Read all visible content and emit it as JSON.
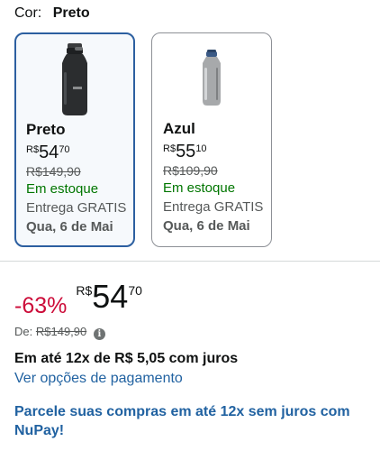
{
  "color_selector": {
    "label": "Cor:",
    "selected": "Preto"
  },
  "options": [
    {
      "name": "Preto",
      "price": {
        "currency": "R$",
        "integer": "54",
        "decimal": "70"
      },
      "list_price": "R$149,90",
      "availability": "Em estoque",
      "shipping": "Entrega GRATIS",
      "delivery_date": "Qua, 6 de Mai",
      "bottle_color": "#2b2d2f",
      "selected": true
    },
    {
      "name": "Azul",
      "price": {
        "currency": "R$",
        "integer": "55",
        "decimal": "10"
      },
      "list_price": "R$109,90",
      "availability": "Em estoque",
      "shipping": "Entrega GRATIS",
      "delivery_date": "Qua, 6 de Mai",
      "bottle_color": "#a7a9ab",
      "selected": false
    }
  ],
  "price_block": {
    "discount": "-63%",
    "currency": "R$",
    "integer": "54",
    "decimal": "70",
    "list_price_label": "De:",
    "list_price": "R$149,90",
    "info_icon": "info-icon"
  },
  "installments": "Em até 12x de R$ 5,05 com juros",
  "payment_link": "Ver opções de pagamento",
  "nupay_promo": "Parcele suas compras em até 12x sem juros com NuPay!",
  "colors": {
    "accent_border": "#2c5fa0",
    "discount_red": "#cc0c39",
    "stock_green": "#007600",
    "link_blue": "#2162a1"
  }
}
